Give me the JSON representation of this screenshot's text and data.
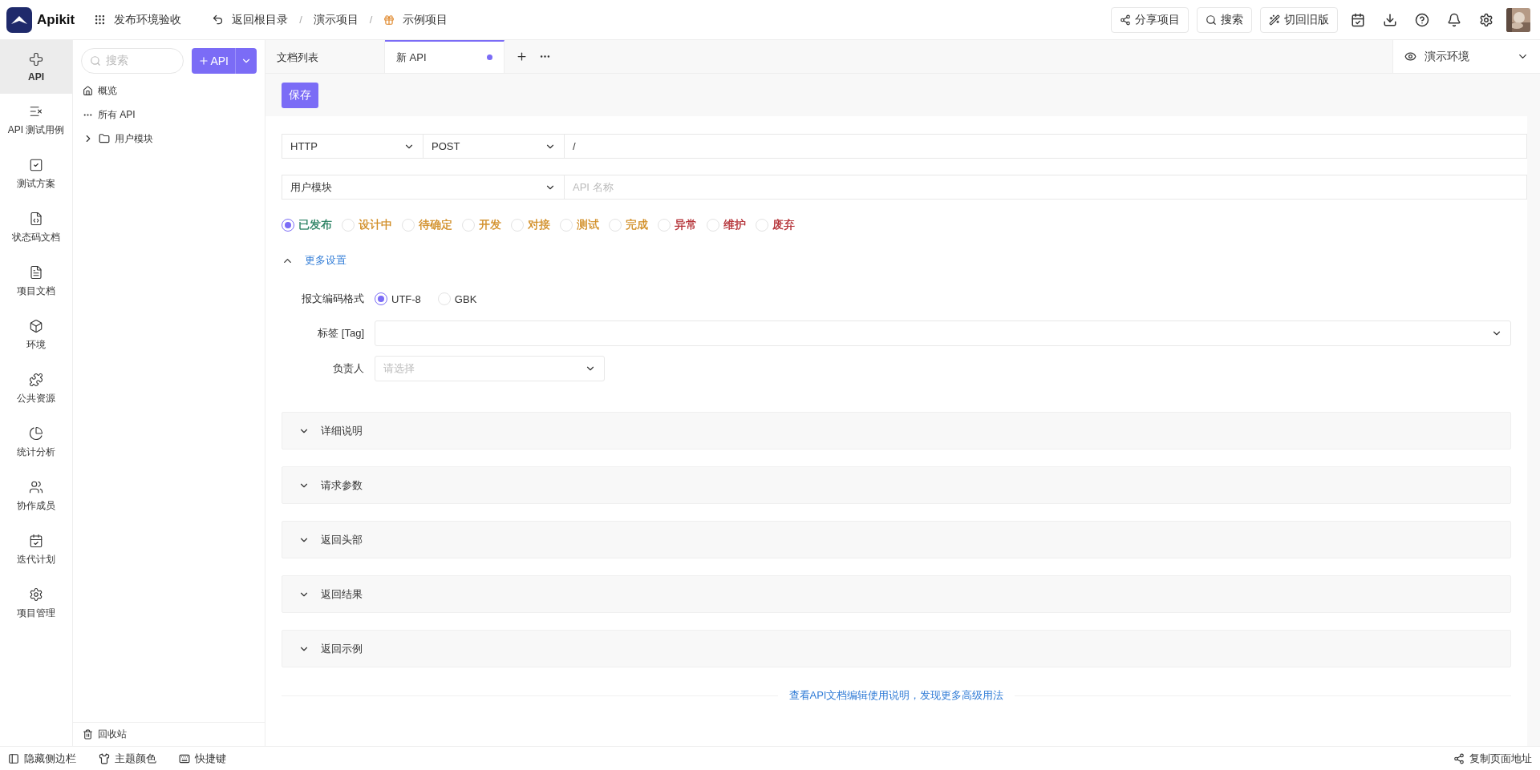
{
  "header": {
    "logo": "Apikit",
    "workspace": "发布环境验收",
    "back": "返回根目录",
    "separator": "/",
    "breadcrumbs": [
      {
        "label": "演示项目",
        "kind": "plain"
      },
      {
        "label": "示例项目",
        "kind": "project"
      }
    ],
    "actions": [
      "分享项目",
      "搜索",
      "切回旧版"
    ]
  },
  "rail": [
    {
      "label": "API",
      "selected": true
    },
    {
      "label": "API 测试用例",
      "selected": false
    },
    {
      "label": "测试方案",
      "selected": false
    },
    {
      "label": "状态码文档",
      "selected": false
    },
    {
      "label": "项目文档",
      "selected": false
    },
    {
      "label": "环境",
      "selected": false
    },
    {
      "label": "公共资源",
      "selected": false
    },
    {
      "label": "统计分析",
      "selected": false
    },
    {
      "label": "协作成员",
      "selected": false
    },
    {
      "label": "迭代计划",
      "selected": false
    },
    {
      "label": "项目管理",
      "selected": false
    }
  ],
  "tree": {
    "search_placeholder": "搜索",
    "add_button": "API",
    "items": [
      {
        "label": "概览",
        "kind": "home"
      },
      {
        "label": "所有 API",
        "kind": "all"
      },
      {
        "label": "用户模块",
        "kind": "folder",
        "expanded": false
      }
    ],
    "trash": "回收站"
  },
  "tabs": [
    {
      "label": "文档列表",
      "selected": false,
      "unsaved": false
    },
    {
      "label": "新 API",
      "selected": true,
      "unsaved": true
    }
  ],
  "environment": "演示环境",
  "save": "保存",
  "protocol": "HTTP",
  "method": "POST",
  "path": "/",
  "group": "用户模块",
  "name_placeholder": "API 名称",
  "statuses": [
    {
      "label": "已发布",
      "selected": true,
      "color": "#1e7a5a"
    },
    {
      "label": "设计中",
      "selected": false,
      "color": "#d08a1e"
    },
    {
      "label": "待确定",
      "selected": false,
      "color": "#d08a1e"
    },
    {
      "label": "开发",
      "selected": false,
      "color": "#d08a1e"
    },
    {
      "label": "对接",
      "selected": false,
      "color": "#d08a1e"
    },
    {
      "label": "测试",
      "selected": false,
      "color": "#d08a1e"
    },
    {
      "label": "完成",
      "selected": false,
      "color": "#d08a1e"
    },
    {
      "label": "异常",
      "selected": false,
      "color": "#b0262c"
    },
    {
      "label": "维护",
      "selected": false,
      "color": "#b0262c"
    },
    {
      "label": "废弃",
      "selected": false,
      "color": "#b0262c"
    }
  ],
  "more_settings": {
    "label": "更多设置",
    "expanded": true
  },
  "encoding": {
    "label": "报文编码格式",
    "options": [
      {
        "label": "UTF-8",
        "selected": true
      },
      {
        "label": "GBK",
        "selected": false
      }
    ]
  },
  "tag": {
    "label": "标签 [Tag]"
  },
  "owner": {
    "label": "负责人",
    "placeholder": "请选择"
  },
  "sections": [
    {
      "label": "详细说明",
      "expanded": false
    },
    {
      "label": "请求参数",
      "expanded": false
    },
    {
      "label": "返回头部",
      "expanded": false
    },
    {
      "label": "返回结果",
      "expanded": false
    },
    {
      "label": "返回示例",
      "expanded": false
    }
  ],
  "help_link": "查看API文档编辑使用说明，发现更多高级用法",
  "footer": {
    "items": [
      "隐藏侧边栏",
      "主题颜色",
      "快捷键"
    ],
    "copy": "复制页面地址"
  }
}
